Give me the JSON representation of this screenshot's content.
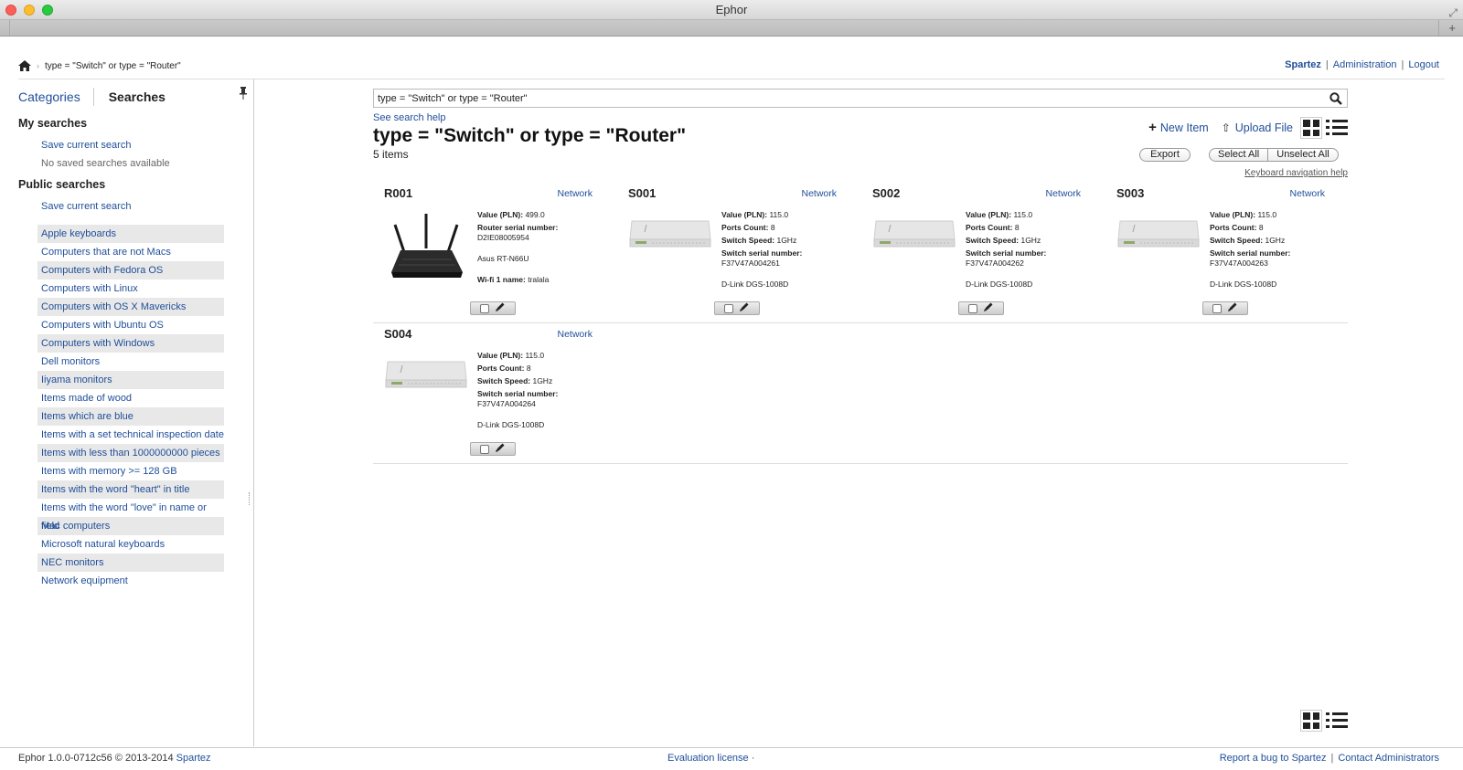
{
  "window": {
    "title": "Ephor"
  },
  "breadcrumb": {
    "current": "type = \"Switch\" or type = \"Router\""
  },
  "toplinks": {
    "user": "Spartez",
    "admin": "Administration",
    "logout": "Logout",
    "sep": "|"
  },
  "sidebar": {
    "tab_categories": "Categories",
    "tab_searches": "Searches",
    "my_searches_title": "My searches",
    "my_save": "Save current search",
    "no_saved": "No saved searches available",
    "public_title": "Public searches",
    "public_save": "Save current search",
    "public_items": [
      "Apple keyboards",
      "Computers that are not Macs",
      "Computers with Fedora OS",
      "Computers with Linux",
      "Computers with OS X Mavericks",
      "Computers with Ubuntu OS",
      "Computers with Windows",
      "Dell monitors",
      "Iiyama monitors",
      "Items made of wood",
      "Items which are blue",
      "Items with a set technical inspection date",
      "Items with less than 1000000000 pieces",
      "Items with memory >= 128 GB",
      "Items with the word \"heart\" in title",
      "Items with the word \"love\" in name or field",
      "Mac computers",
      "Microsoft natural keyboards",
      "NEC monitors",
      "Network equipment"
    ]
  },
  "search": {
    "query": "type = \"Switch\" or type = \"Router\"",
    "help": "See search help",
    "title": "type = \"Switch\" or type = \"Router\"",
    "count": "5 items"
  },
  "toolbar": {
    "new_item": "New Item",
    "upload_file": "Upload File",
    "export": "Export",
    "select_all": "Select All",
    "unselect_all": "Unselect All",
    "keyboard_help": "Keyboard navigation help"
  },
  "items": [
    {
      "id": "R001",
      "category": "Network",
      "kind": "router",
      "props": [
        {
          "label": "Value (PLN):",
          "value": "499.0",
          "inline": true
        },
        {
          "label": "Router serial number:",
          "value": "D2IE08005954",
          "inline": false
        },
        {
          "label": "",
          "value": "Asus RT-N66U",
          "inline": true,
          "gap": true
        },
        {
          "label": "Wi-fi 1 name:",
          "value": "tralala",
          "inline": true,
          "gap": true
        }
      ]
    },
    {
      "id": "S001",
      "category": "Network",
      "kind": "switch",
      "props": [
        {
          "label": "Value (PLN):",
          "value": "115.0",
          "inline": true
        },
        {
          "label": "Ports Count:",
          "value": "8",
          "inline": true
        },
        {
          "label": "Switch Speed:",
          "value": "1GHz",
          "inline": true
        },
        {
          "label": "Switch serial number:",
          "value": "F37V47A004261",
          "inline": false
        },
        {
          "label": "",
          "value": "D-Link DGS-1008D",
          "inline": true,
          "gap": true
        }
      ]
    },
    {
      "id": "S002",
      "category": "Network",
      "kind": "switch",
      "props": [
        {
          "label": "Value (PLN):",
          "value": "115.0",
          "inline": true
        },
        {
          "label": "Ports Count:",
          "value": "8",
          "inline": true
        },
        {
          "label": "Switch Speed:",
          "value": "1GHz",
          "inline": true
        },
        {
          "label": "Switch serial number:",
          "value": "F37V47A004262",
          "inline": false
        },
        {
          "label": "",
          "value": "D-Link DGS-1008D",
          "inline": true,
          "gap": true
        }
      ]
    },
    {
      "id": "S003",
      "category": "Network",
      "kind": "switch",
      "props": [
        {
          "label": "Value (PLN):",
          "value": "115.0",
          "inline": true
        },
        {
          "label": "Ports Count:",
          "value": "8",
          "inline": true
        },
        {
          "label": "Switch Speed:",
          "value": "1GHz",
          "inline": true
        },
        {
          "label": "Switch serial number:",
          "value": "F37V47A004263",
          "inline": false
        },
        {
          "label": "",
          "value": "D-Link DGS-1008D",
          "inline": true,
          "gap": true
        }
      ]
    },
    {
      "id": "S004",
      "category": "Network",
      "kind": "switch",
      "props": [
        {
          "label": "Value (PLN):",
          "value": "115.0",
          "inline": true
        },
        {
          "label": "Ports Count:",
          "value": "8",
          "inline": true
        },
        {
          "label": "Switch Speed:",
          "value": "1GHz",
          "inline": true
        },
        {
          "label": "Switch serial number:",
          "value": "F37V47A004264",
          "inline": false
        },
        {
          "label": "",
          "value": "D-Link DGS-1008D",
          "inline": true,
          "gap": true
        }
      ]
    }
  ],
  "footer": {
    "version": "Ephor 1.0.0-0712c56 © 2013-2014",
    "company": "Spartez",
    "license": "Evaluation license ·",
    "report_bug": "Report a bug to Spartez",
    "sep": "|",
    "contact": "Contact Administrators"
  },
  "colors": {
    "link": "#1f4e99",
    "alt_row": "#e8e8e8"
  }
}
